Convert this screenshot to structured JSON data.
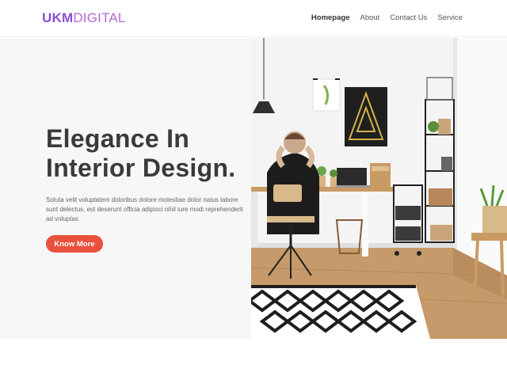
{
  "brand": {
    "logo_bold": "UKM",
    "logo_light": "DIGITAL",
    "color_primary": "#8a4fd6",
    "color_secondary": "#b36ad2"
  },
  "nav": {
    "items": [
      {
        "label": "Homepage",
        "active": true
      },
      {
        "label": "About"
      },
      {
        "label": "Contact Us"
      },
      {
        "label": "Service"
      }
    ]
  },
  "hero": {
    "title_line1": "Elegance In",
    "title_line2": "Interior Design.",
    "description": "Soluta velit voluptatem doloribus dolore molestiae dolor natus labore sunt delectus, est deserunt officia adipisci nihil iure modi reprehenderit ad voluptas",
    "button_label": "Know More",
    "button_color": "#e8513e",
    "image": "interior-office-photo"
  }
}
